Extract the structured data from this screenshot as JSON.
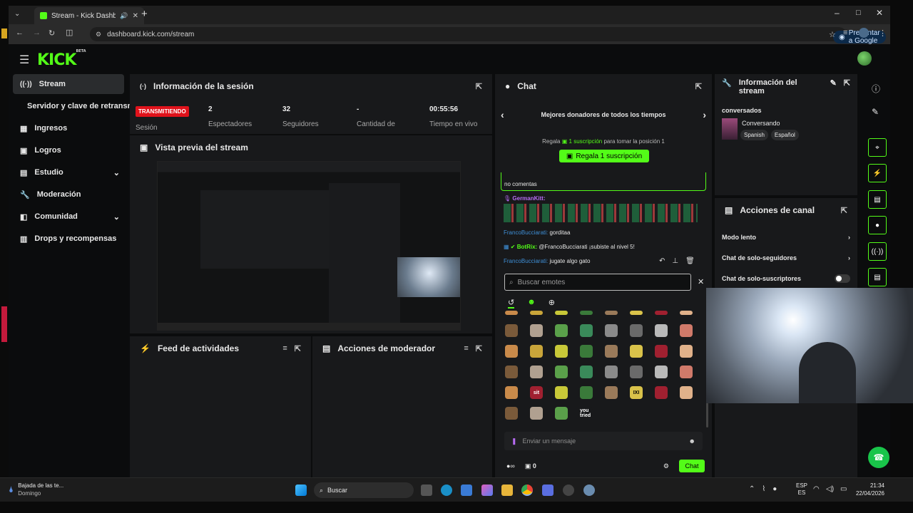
{
  "browser": {
    "tab_title": "Stream - Kick Dashboard",
    "url": "dashboard.kick.com/stream",
    "ask_google": "Preguntar a Google"
  },
  "app": {
    "logo": "KICK",
    "logo_badge": "BETA"
  },
  "sidebar": {
    "items": [
      {
        "label": "Stream",
        "icon": "broadcast-icon"
      },
      {
        "label": "Servidor y clave de retransn"
      },
      {
        "label": "Ingresos",
        "icon": "chart-icon"
      },
      {
        "label": "Logros",
        "icon": "trophy-icon"
      },
      {
        "label": "Estudio",
        "icon": "studio-icon"
      },
      {
        "label": "Moderación",
        "icon": "wrench-icon"
      },
      {
        "label": "Comunidad",
        "icon": "community-icon"
      },
      {
        "label": "Drops y recompensas",
        "icon": "drops-icon"
      }
    ]
  },
  "session": {
    "title": "Información de la sesión",
    "live_badge": "TRANSMITIENDO",
    "session_label": "Sesión",
    "stats": [
      {
        "value": "2",
        "label": "Espectadores"
      },
      {
        "value": "32",
        "label": "Seguidores"
      },
      {
        "value": "-",
        "label": "Cantidad de"
      },
      {
        "value": "00:55:56",
        "label": "Tiempo en vivo"
      }
    ]
  },
  "preview": {
    "title": "Vista previa del stream"
  },
  "activity_feed": {
    "title": "Feed de actividades"
  },
  "mod_actions": {
    "title": "Acciones de moderador"
  },
  "chat": {
    "title": "Chat",
    "top_donors": "Mejores donadores de todos los tiempos",
    "gift_prefix": "Regala",
    "gift_highlight": "1 suscripción",
    "gift_suffix": "para tomar la posición 1",
    "gift_button": "Regala 1 suscripción",
    "partial_line": "no comentas",
    "messages": [
      {
        "user": "GermanKitt:",
        "text": ""
      },
      {
        "user": "FrancoBucciarati:",
        "text": "gorditaa"
      },
      {
        "user": "BotRix:",
        "text": "@FrancoBucciarati ¡subiste al nivel 5!"
      },
      {
        "user": "FrancoBucciarati:",
        "text": "jugate algo gato"
      }
    ],
    "emote_search_placeholder": "Buscar emotes",
    "message_placeholder": "Enviar un mensaje",
    "points": "0",
    "send_button": "Chat",
    "emote_labels": [
      "sit",
      "IXI",
      "you tried"
    ]
  },
  "stream_info": {
    "title": "Información del stream",
    "stream_title": "conversados",
    "category": "Conversando",
    "tags": [
      "Spanish",
      "Español"
    ]
  },
  "channel_actions": {
    "title": "Acciones de canal",
    "items": [
      {
        "label": "Modo lento"
      },
      {
        "label": "Chat de solo-seguidores"
      },
      {
        "label": "Chat de solo-suscriptores"
      }
    ]
  },
  "taskbar": {
    "weather_title": "Bajada de las te...",
    "weather_sub": "Domingo",
    "search": "Buscar",
    "lang_top": "ESP",
    "lang_bottom": "ES",
    "time": "21:34",
    "date": "22/04/2026"
  },
  "colors": {
    "accent": "#53fc18",
    "live": "#e0121b",
    "panel": "#18191b"
  }
}
